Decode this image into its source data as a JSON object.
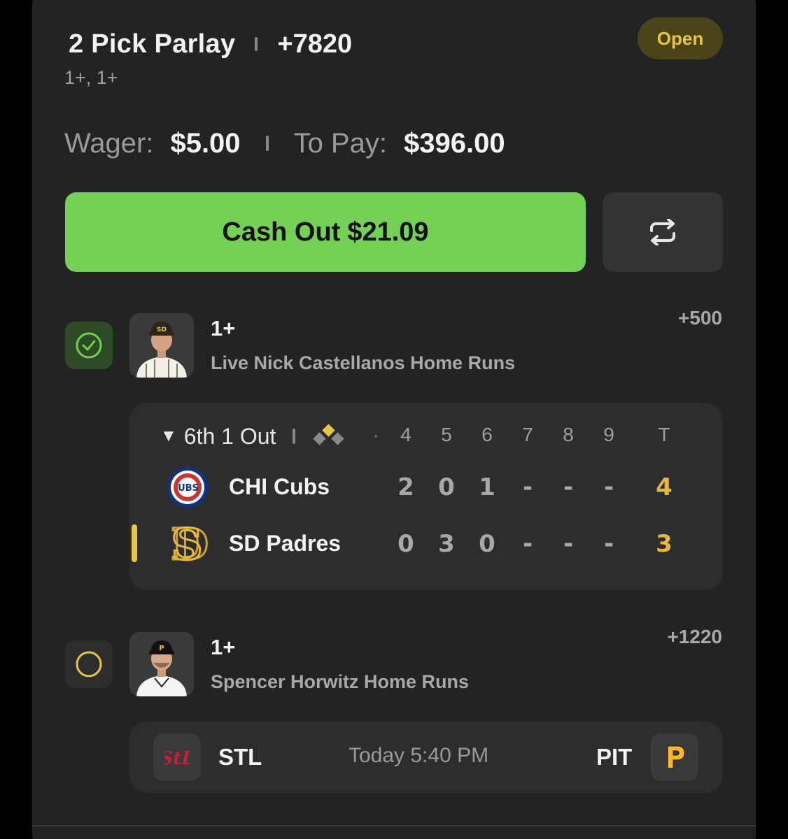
{
  "bet": {
    "title": "2 Pick Parlay",
    "odds": "+7820",
    "subtitle": "1+, 1+",
    "status": "Open",
    "wager_label": "Wager:",
    "wager_value": "$5.00",
    "topay_label": "To Pay:",
    "topay_value": "$396.00",
    "cashout_label": "Cash Out",
    "cashout_amount": "$21.09"
  },
  "legs": [
    {
      "line": "1+",
      "market": "Live Nick Castellanos Home Runs",
      "odds": "+500",
      "state": "won",
      "scoreboard": {
        "inning_status": "6th 1 Out",
        "innings": [
          "4",
          "5",
          "6",
          "7",
          "8",
          "9",
          "T"
        ],
        "teams": [
          {
            "name": "CHI Cubs",
            "scores": [
              "2",
              "0",
              "1",
              "-",
              "-",
              "-"
            ],
            "total": "4",
            "logo_icon": "cubs-logo-icon",
            "batting": false
          },
          {
            "name": "SD Padres",
            "scores": [
              "0",
              "3",
              "0",
              "-",
              "-",
              "-"
            ],
            "total": "3",
            "logo_icon": "padres-logo-icon",
            "batting": true
          }
        ]
      }
    },
    {
      "line": "1+",
      "market": "Spencer Horwitz Home Runs",
      "odds": "+1220",
      "state": "pending",
      "game": {
        "away": "STL",
        "home": "PIT",
        "time": "Today 5:40 PM",
        "away_icon": "cardinals-logo-icon",
        "home_icon": "pirates-logo-icon"
      }
    }
  ],
  "colors": {
    "card_bg": "#232323",
    "cashout_green": "#74d155",
    "status_pill_bg": "#4b4418",
    "status_pill_text": "#e8c640",
    "total_gold": "#e8b83a",
    "check_green": "#6ed14e",
    "pending_yellow": "#e8c640"
  }
}
